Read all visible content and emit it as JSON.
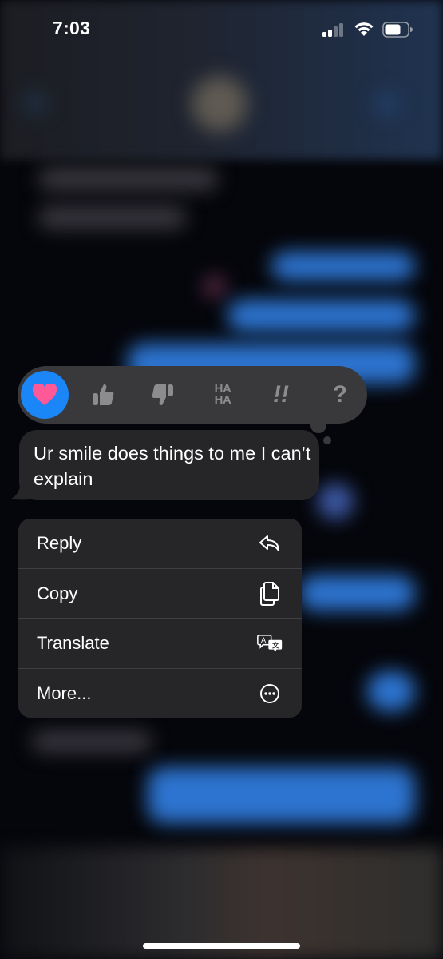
{
  "status_bar": {
    "time": "7:03",
    "signal_bars": 2,
    "signal_bars_total": 4,
    "wifi": "full",
    "battery_percent": 70
  },
  "tapbacks": [
    {
      "name": "heart",
      "label": "Love",
      "selected": true,
      "icon": "heart-icon"
    },
    {
      "name": "thumbs-up",
      "label": "Like",
      "selected": false,
      "icon": "thumbs-up-icon"
    },
    {
      "name": "thumbs-down",
      "label": "Dislike",
      "selected": false,
      "icon": "thumbs-down-icon"
    },
    {
      "name": "haha",
      "label": "Laugh",
      "selected": false,
      "icon": "haha-icon",
      "text_top": "HA",
      "text_bottom": "HA"
    },
    {
      "name": "emphasize",
      "label": "Emphasize",
      "selected": false,
      "icon": "double-exclamation-icon",
      "text": "!!"
    },
    {
      "name": "question",
      "label": "Question",
      "selected": false,
      "icon": "question-icon",
      "text": "?"
    }
  ],
  "colors": {
    "selected_tapback_bg": "#1a86f7",
    "heart": "#ff5a97",
    "tapback_bar": "#39393b",
    "bubble": "#262628",
    "icon_inactive": "#8c8c8e"
  },
  "message": {
    "text": "Ur smile does things to me I can’t explain",
    "direction": "received"
  },
  "context_menu": {
    "items": [
      {
        "label": "Reply",
        "icon": "reply-icon"
      },
      {
        "label": "Copy",
        "icon": "copy-icon"
      },
      {
        "label": "Translate",
        "icon": "translate-icon"
      },
      {
        "label": "More...",
        "icon": "more-icon"
      }
    ]
  }
}
